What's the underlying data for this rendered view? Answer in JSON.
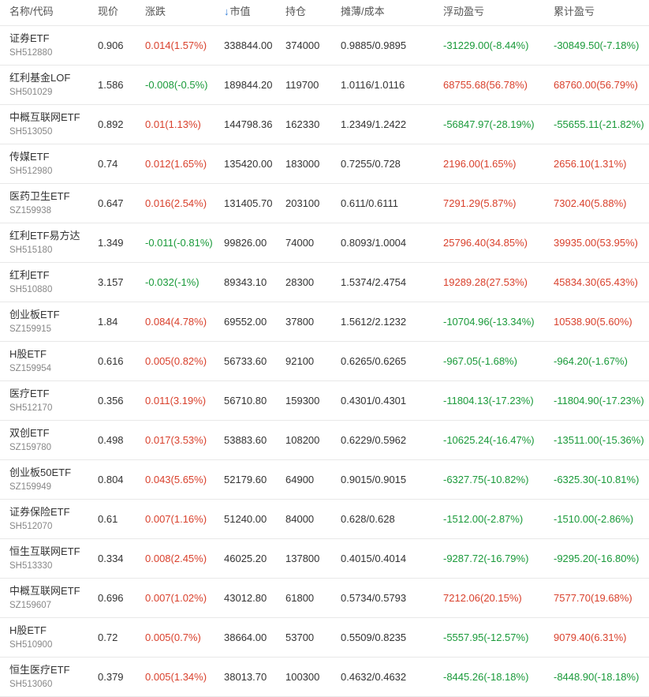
{
  "header": {
    "name": "名称/代码",
    "price": "现价",
    "change": "涨跌",
    "sort_arrow": "↓",
    "market_value": "市值",
    "position": "持仓",
    "cost": "摊薄/成本",
    "float_pl": "浮动盈亏",
    "total_pl": "累计盈亏"
  },
  "colors": {
    "up": "#d9412d",
    "down": "#1a9a3a",
    "sort_arrow": "#2e7cd6"
  },
  "rows": [
    {
      "name": "证券ETF",
      "code": "SH512880",
      "price": "0.906",
      "change": "0.014(1.57%)",
      "change_dir": "up",
      "market_value": "338844.00",
      "position": "374000",
      "cost": "0.9885/0.9895",
      "float_pl": "-31229.00(-8.44%)",
      "float_dir": "down",
      "total_pl": "-30849.50(-7.18%)",
      "total_dir": "down"
    },
    {
      "name": "红利基金LOF",
      "code": "SH501029",
      "price": "1.586",
      "change": "-0.008(-0.5%)",
      "change_dir": "down",
      "market_value": "189844.20",
      "position": "119700",
      "cost": "1.0116/1.0116",
      "float_pl": "68755.68(56.78%)",
      "float_dir": "up",
      "total_pl": "68760.00(56.79%)",
      "total_dir": "up"
    },
    {
      "name": "中概互联网ETF",
      "code": "SH513050",
      "price": "0.892",
      "change": "0.01(1.13%)",
      "change_dir": "up",
      "market_value": "144798.36",
      "position": "162330",
      "cost": "1.2349/1.2422",
      "float_pl": "-56847.97(-28.19%)",
      "float_dir": "down",
      "total_pl": "-55655.11(-21.82%)",
      "total_dir": "down"
    },
    {
      "name": "传媒ETF",
      "code": "SH512980",
      "price": "0.74",
      "change": "0.012(1.65%)",
      "change_dir": "up",
      "market_value": "135420.00",
      "position": "183000",
      "cost": "0.7255/0.728",
      "float_pl": "2196.00(1.65%)",
      "float_dir": "up",
      "total_pl": "2656.10(1.31%)",
      "total_dir": "up"
    },
    {
      "name": "医药卫生ETF",
      "code": "SZ159938",
      "price": "0.647",
      "change": "0.016(2.54%)",
      "change_dir": "up",
      "market_value": "131405.70",
      "position": "203100",
      "cost": "0.611/0.6111",
      "float_pl": "7291.29(5.87%)",
      "float_dir": "up",
      "total_pl": "7302.40(5.88%)",
      "total_dir": "up"
    },
    {
      "name": "红利ETF易方达",
      "code": "SH515180",
      "price": "1.349",
      "change": "-0.011(-0.81%)",
      "change_dir": "down",
      "market_value": "99826.00",
      "position": "74000",
      "cost": "0.8093/1.0004",
      "float_pl": "25796.40(34.85%)",
      "float_dir": "up",
      "total_pl": "39935.00(53.95%)",
      "total_dir": "up"
    },
    {
      "name": "红利ETF",
      "code": "SH510880",
      "price": "3.157",
      "change": "-0.032(-1%)",
      "change_dir": "down",
      "market_value": "89343.10",
      "position": "28300",
      "cost": "1.5374/2.4754",
      "float_pl": "19289.28(27.53%)",
      "float_dir": "up",
      "total_pl": "45834.30(65.43%)",
      "total_dir": "up"
    },
    {
      "name": "创业板ETF",
      "code": "SZ159915",
      "price": "1.84",
      "change": "0.084(4.78%)",
      "change_dir": "up",
      "market_value": "69552.00",
      "position": "37800",
      "cost": "1.5612/2.1232",
      "float_pl": "-10704.96(-13.34%)",
      "float_dir": "down",
      "total_pl": "10538.90(5.60%)",
      "total_dir": "up"
    },
    {
      "name": "H股ETF",
      "code": "SZ159954",
      "price": "0.616",
      "change": "0.005(0.82%)",
      "change_dir": "up",
      "market_value": "56733.60",
      "position": "92100",
      "cost": "0.6265/0.6265",
      "float_pl": "-967.05(-1.68%)",
      "float_dir": "down",
      "total_pl": "-964.20(-1.67%)",
      "total_dir": "down"
    },
    {
      "name": "医疗ETF",
      "code": "SH512170",
      "price": "0.356",
      "change": "0.011(3.19%)",
      "change_dir": "up",
      "market_value": "56710.80",
      "position": "159300",
      "cost": "0.4301/0.4301",
      "float_pl": "-11804.13(-17.23%)",
      "float_dir": "down",
      "total_pl": "-11804.90(-17.23%)",
      "total_dir": "down"
    },
    {
      "name": "双创ETF",
      "code": "SZ159780",
      "price": "0.498",
      "change": "0.017(3.53%)",
      "change_dir": "up",
      "market_value": "53883.60",
      "position": "108200",
      "cost": "0.6229/0.5962",
      "float_pl": "-10625.24(-16.47%)",
      "float_dir": "down",
      "total_pl": "-13511.00(-15.36%)",
      "total_dir": "down"
    },
    {
      "name": "创业板50ETF",
      "code": "SZ159949",
      "price": "0.804",
      "change": "0.043(5.65%)",
      "change_dir": "up",
      "market_value": "52179.60",
      "position": "64900",
      "cost": "0.9015/0.9015",
      "float_pl": "-6327.75(-10.82%)",
      "float_dir": "down",
      "total_pl": "-6325.30(-10.81%)",
      "total_dir": "down"
    },
    {
      "name": "证券保险ETF",
      "code": "SH512070",
      "price": "0.61",
      "change": "0.007(1.16%)",
      "change_dir": "up",
      "market_value": "51240.00",
      "position": "84000",
      "cost": "0.628/0.628",
      "float_pl": "-1512.00(-2.87%)",
      "float_dir": "down",
      "total_pl": "-1510.00(-2.86%)",
      "total_dir": "down"
    },
    {
      "name": "恒生互联网ETF",
      "code": "SH513330",
      "price": "0.334",
      "change": "0.008(2.45%)",
      "change_dir": "up",
      "market_value": "46025.20",
      "position": "137800",
      "cost": "0.4015/0.4014",
      "float_pl": "-9287.72(-16.79%)",
      "float_dir": "down",
      "total_pl": "-9295.20(-16.80%)",
      "total_dir": "down"
    },
    {
      "name": "中概互联网ETF",
      "code": "SZ159607",
      "price": "0.696",
      "change": "0.007(1.02%)",
      "change_dir": "up",
      "market_value": "43012.80",
      "position": "61800",
      "cost": "0.5734/0.5793",
      "float_pl": "7212.06(20.15%)",
      "float_dir": "up",
      "total_pl": "7577.70(19.68%)",
      "total_dir": "up"
    },
    {
      "name": "H股ETF",
      "code": "SH510900",
      "price": "0.72",
      "change": "0.005(0.7%)",
      "change_dir": "up",
      "market_value": "38664.00",
      "position": "53700",
      "cost": "0.5509/0.8235",
      "float_pl": "-5557.95(-12.57%)",
      "float_dir": "down",
      "total_pl": "9079.40(6.31%)",
      "total_dir": "up"
    },
    {
      "name": "恒生医疗ETF",
      "code": "SH513060",
      "price": "0.379",
      "change": "0.005(1.34%)",
      "change_dir": "up",
      "market_value": "38013.70",
      "position": "100300",
      "cost": "0.4632/0.4632",
      "float_pl": "-8445.26(-18.18%)",
      "float_dir": "down",
      "total_pl": "-8448.90(-18.18%)",
      "total_dir": "down"
    }
  ]
}
